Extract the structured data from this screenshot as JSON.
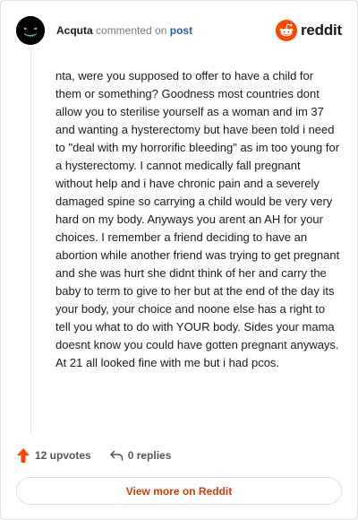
{
  "header": {
    "username": "Acquta",
    "action_text": "commented on",
    "post_link_label": "post"
  },
  "brand": {
    "name": "reddit",
    "logo_icon": "reddit-logo-icon",
    "accent_color": "#ff4500"
  },
  "comment": {
    "text": "nta, were you supposed to offer to have a child for them or something? Goodness most countries dont allow you to sterilise yourself as a woman and im 37 and wanting a hysterectomy but have been told i need to \"deal with my horrorific bleeding\" as im too young for a hysterectomy. I cannot medically fall pregnant without help and i have chronic pain and a severely damaged spine so carrying a child would be very very hard on my body. Anyways you arent an AH for your choices. I remember a friend deciding to have an abortion while another friend was trying to get pregnant and she was hurt she didnt think of her and carry the baby to term to give to her but at the end of the day its your body, your choice and noone else has a right to tell you what to do with YOUR body. Sides your mama doesnt know you could have gotten pregnant anyways. At 21 all looked fine with me but i had pcos."
  },
  "actions": {
    "upvotes_label": "12 upvotes",
    "upvote_icon": "upvote-arrow-icon",
    "replies_label": "0 replies",
    "reply_icon": "reply-icon"
  },
  "footer": {
    "view_more_label": "View more on Reddit",
    "link_color": "#d93a00"
  }
}
